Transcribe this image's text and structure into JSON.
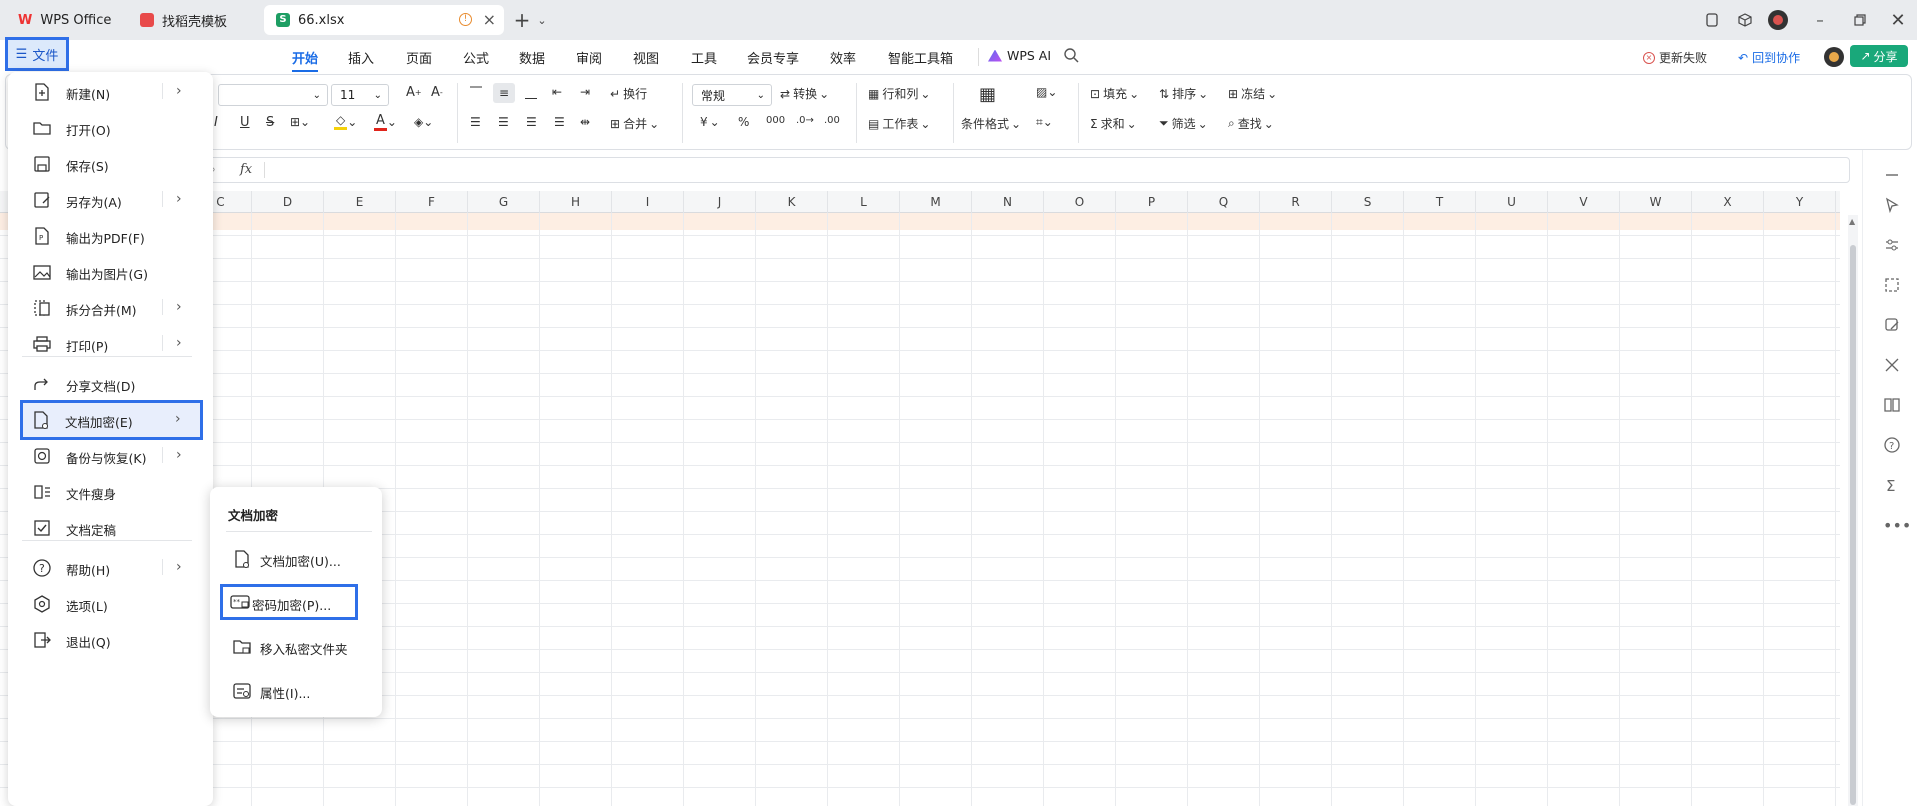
{
  "tabs": [
    {
      "label": "WPS Office",
      "icon": "wps-logo-icon"
    },
    {
      "label": "找稻壳模板",
      "icon": "docer-icon"
    },
    {
      "label": "66.xlsx",
      "icon": "spreadsheet-icon"
    }
  ],
  "menu": {
    "file_label": "文件",
    "tabs": [
      "开始",
      "插入",
      "页面",
      "公式",
      "数据",
      "审阅",
      "视图",
      "工具",
      "会员专享",
      "效率",
      "智能工具箱"
    ],
    "active_tab": "开始",
    "wps_ai": "WPS AI",
    "update_failed": "更新失败",
    "back_to_collab": "回到协作",
    "share": "分享"
  },
  "ribbon": {
    "font_size": "11",
    "wrap": "换行",
    "number_format": "常规",
    "convert": "转换",
    "row_col": "行和列",
    "merge": "合并",
    "worksheet": "工作表",
    "cond_format": "条件格式",
    "fill": "填充",
    "sort": "排序",
    "freeze": "冻结",
    "sum": "求和",
    "filter": "筛选",
    "find": "查找",
    "currency": "¥",
    "percent": "%"
  },
  "formula_bar": {
    "fx": "fx",
    "value": ""
  },
  "columns": [
    "C",
    "D",
    "E",
    "F",
    "G",
    "H",
    "I",
    "J",
    "K",
    "L",
    "M",
    "N",
    "O",
    "P",
    "Q",
    "R",
    "S",
    "T",
    "U",
    "V",
    "W",
    "X",
    "Y"
  ],
  "file_menu": {
    "items": [
      {
        "label": "新建(N)",
        "icon": "new-file-icon",
        "arrow": true
      },
      {
        "label": "打开(O)",
        "icon": "folder-open-icon",
        "arrow": false
      },
      {
        "label": "保存(S)",
        "icon": "save-icon",
        "arrow": false
      },
      {
        "label": "另存为(A)",
        "icon": "save-as-icon",
        "arrow": true
      },
      {
        "label": "输出为PDF(F)",
        "icon": "pdf-icon",
        "arrow": false
      },
      {
        "label": "输出为图片(G)",
        "icon": "image-export-icon",
        "arrow": false
      },
      {
        "label": "拆分合并(M)",
        "icon": "split-merge-icon",
        "arrow": true
      },
      {
        "label": "打印(P)",
        "icon": "print-icon",
        "arrow": true
      },
      {
        "label": "分享文档(D)",
        "icon": "share-doc-icon",
        "arrow": false
      },
      {
        "label": "文档加密(E)",
        "icon": "doc-encrypt-icon",
        "arrow": true
      },
      {
        "label": "备份与恢复(K)",
        "icon": "backup-icon",
        "arrow": true
      },
      {
        "label": "文件瘦身",
        "icon": "slim-file-icon",
        "arrow": false
      },
      {
        "label": "文档定稿",
        "icon": "finalize-icon",
        "arrow": false
      },
      {
        "label": "帮助(H)",
        "icon": "help-icon",
        "arrow": true
      },
      {
        "label": "选项(L)",
        "icon": "options-icon",
        "arrow": false
      },
      {
        "label": "退出(Q)",
        "icon": "exit-icon",
        "arrow": false
      }
    ],
    "arrow_glyph": "›"
  },
  "submenu": {
    "title": "文档加密",
    "items": [
      {
        "label": "文档加密(U)...",
        "icon": "doc-lock-icon"
      },
      {
        "label": "密码加密(P)...",
        "icon": "password-icon"
      },
      {
        "label": "移入私密文件夹",
        "icon": "private-folder-icon"
      },
      {
        "label": "属性(I)...",
        "icon": "properties-icon"
      }
    ]
  },
  "colors": {
    "accent": "#1a6ce6",
    "highlight_border": "#2f6fe8",
    "share_bg": "#19a87a",
    "row_highlight": "#fdeee3"
  }
}
